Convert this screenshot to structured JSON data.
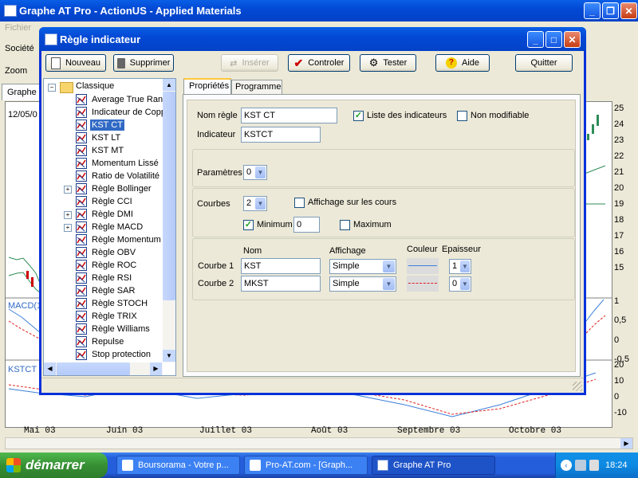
{
  "main_window": {
    "title": "Graphe AT Pro - ActionUS - Applied Materials",
    "menu": [
      "Fichier"
    ],
    "societe_label": "Société",
    "zoom_label": "Zoom",
    "tab_label": "Graphe",
    "chart_date": "12/05/0",
    "macd_label": "MACD(1",
    "kst_label": "KSTCT",
    "price_axis": [
      "25",
      "24",
      "23",
      "22",
      "21",
      "20",
      "19",
      "18",
      "17",
      "16",
      "15"
    ],
    "macd_axis": [
      "1",
      "0,5",
      "0",
      "-0,5"
    ],
    "kst_axis": [
      "20",
      "10",
      "0",
      "-10"
    ],
    "months": [
      "Mai 03",
      "Juin 03",
      "Juillet 03",
      "Août 03",
      "Septembre 03",
      "Octobre 03"
    ]
  },
  "dialog": {
    "title": "Règle indicateur",
    "toolbar": {
      "nouveau": "Nouveau",
      "supprimer": "Supprimer",
      "inserer": "Insérer",
      "controler": "Controler",
      "tester": "Tester",
      "aide": "Aide",
      "quitter": "Quitter"
    },
    "tree": {
      "root": "Classique",
      "items": [
        {
          "label": "Average True Rang",
          "expand": false
        },
        {
          "label": "Indicateur de Copp",
          "expand": false
        },
        {
          "label": "KST CT",
          "expand": false,
          "selected": true
        },
        {
          "label": "KST LT",
          "expand": false
        },
        {
          "label": "KST MT",
          "expand": false
        },
        {
          "label": "Momentum Lissé",
          "expand": false
        },
        {
          "label": "Ratio de Volatilité",
          "expand": false
        },
        {
          "label": "Règle Bollinger",
          "expand": true
        },
        {
          "label": "Règle CCI",
          "expand": false
        },
        {
          "label": "Règle DMI",
          "expand": true
        },
        {
          "label": "Règle MACD",
          "expand": true
        },
        {
          "label": "Règle Momentum",
          "expand": false
        },
        {
          "label": "Règle OBV",
          "expand": false
        },
        {
          "label": "Règle ROC",
          "expand": false
        },
        {
          "label": "Règle RSI",
          "expand": false
        },
        {
          "label": "Règle SAR",
          "expand": false
        },
        {
          "label": "Règle STOCH",
          "expand": false
        },
        {
          "label": "Règle TRIX",
          "expand": false
        },
        {
          "label": "Règle Williams",
          "expand": false
        },
        {
          "label": "Repulse",
          "expand": false
        },
        {
          "label": "Stop protection",
          "expand": false
        }
      ]
    },
    "tabs": [
      "Propriétés",
      "Programme"
    ],
    "props": {
      "nom_regle_label": "Nom règle",
      "nom_regle_value": "KST CT",
      "indicateur_label": "Indicateur",
      "indicateur_value": "KSTCT",
      "liste_label": "Liste des indicateurs",
      "liste_checked": true,
      "non_modifiable_label": "Non modifiable",
      "non_modifiable_checked": false,
      "parametres_label": "Paramètres",
      "parametres_value": "0",
      "courbes_label": "Courbes",
      "courbes_value": "2",
      "affichage_cours_label": "Affichage sur les cours",
      "minimum_label": "Minimum",
      "minimum_checked": true,
      "minimum_value": "0",
      "maximum_label": "Maximum",
      "col_nom": "Nom",
      "col_affichage": "Affichage",
      "col_couleur": "Couleur",
      "col_epaisseur": "Epaisseur",
      "courbe1_label": "Courbe 1",
      "courbe1_nom": "KST",
      "courbe1_affichage": "Simple",
      "courbe1_color": "#3c7fd8",
      "courbe1_epaisseur": "1",
      "courbe2_label": "Courbe 2",
      "courbe2_nom": "MKST",
      "courbe2_affichage": "Simple",
      "courbe2_color": "#e02020",
      "courbe2_epaisseur": "0"
    }
  },
  "taskbar": {
    "start": "démarrer",
    "tasks": [
      "Boursorama - Votre p...",
      "Pro-AT.com - [Graph...",
      "Graphe AT Pro"
    ],
    "clock": "18:24"
  }
}
